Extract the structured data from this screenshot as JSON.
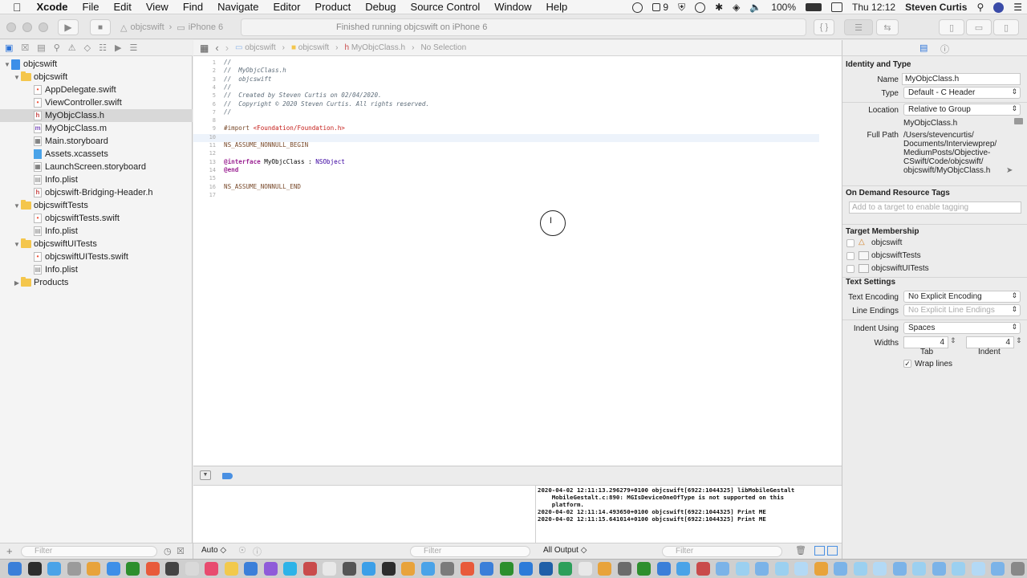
{
  "menubar": {
    "apple": "",
    "app_name": "Xcode",
    "items": [
      "File",
      "Edit",
      "View",
      "Find",
      "Navigate",
      "Editor",
      "Product",
      "Debug",
      "Source Control",
      "Window",
      "Help"
    ],
    "right": {
      "badge": "9",
      "battery": "100%",
      "clock": "Thu 12:12",
      "user": "Steven Curtis"
    }
  },
  "toolbar": {
    "scheme": "objcswift",
    "device": "iPhone 6",
    "activity_status": "Finished running objcswift on iPhone 6"
  },
  "navigator": {
    "rows": [
      {
        "label": "objcswift",
        "kind": "project",
        "level": 0,
        "open": true
      },
      {
        "label": "objcswift",
        "kind": "folder",
        "level": 1,
        "open": true
      },
      {
        "label": "AppDelegate.swift",
        "kind": "swift",
        "level": 2
      },
      {
        "label": "ViewController.swift",
        "kind": "swift",
        "level": 2
      },
      {
        "label": "MyObjcClass.h",
        "kind": "h",
        "level": 2,
        "selected": true
      },
      {
        "label": "MyObjcClass.m",
        "kind": "m",
        "level": 2
      },
      {
        "label": "Main.storyboard",
        "kind": "storyboard",
        "level": 2
      },
      {
        "label": "Assets.xcassets",
        "kind": "assets",
        "level": 2
      },
      {
        "label": "LaunchScreen.storyboard",
        "kind": "storyboard",
        "level": 2
      },
      {
        "label": "Info.plist",
        "kind": "plist",
        "level": 2
      },
      {
        "label": "objcswift-Bridging-Header.h",
        "kind": "h",
        "level": 2
      },
      {
        "label": "objcswiftTests",
        "kind": "folder",
        "level": 1,
        "open": true
      },
      {
        "label": "objcswiftTests.swift",
        "kind": "swift",
        "level": 2
      },
      {
        "label": "Info.plist",
        "kind": "plist",
        "level": 2
      },
      {
        "label": "objcswiftUITests",
        "kind": "folder",
        "level": 1,
        "open": true
      },
      {
        "label": "objcswiftUITests.swift",
        "kind": "swift",
        "level": 2
      },
      {
        "label": "Info.plist",
        "kind": "plist",
        "level": 2
      },
      {
        "label": "Products",
        "kind": "folder",
        "level": 1,
        "open": false
      }
    ],
    "filter_placeholder": "Filter"
  },
  "jumpbar": {
    "crumbs": [
      "objcswift",
      "objcswift",
      "MyObjcClass.h",
      "No Selection"
    ]
  },
  "editor": {
    "lines": [
      {
        "n": "1",
        "parts": [
          {
            "t": "//",
            "c": "cmt"
          }
        ]
      },
      {
        "n": "2",
        "parts": [
          {
            "t": "//  MyObjcClass.h",
            "c": "cmt"
          }
        ]
      },
      {
        "n": "3",
        "parts": [
          {
            "t": "//  objcswift",
            "c": "cmt"
          }
        ]
      },
      {
        "n": "4",
        "parts": [
          {
            "t": "//",
            "c": "cmt"
          }
        ]
      },
      {
        "n": "5",
        "parts": [
          {
            "t": "//  Created by Steven Curtis on 02/04/2020.",
            "c": "cmt"
          }
        ]
      },
      {
        "n": "6",
        "parts": [
          {
            "t": "//  Copyright © 2020 Steven Curtis. All rights reserved.",
            "c": "cmt"
          }
        ]
      },
      {
        "n": "7",
        "parts": [
          {
            "t": "//",
            "c": "cmt"
          }
        ]
      },
      {
        "n": "8",
        "parts": []
      },
      {
        "n": "9",
        "parts": [
          {
            "t": "#import ",
            "c": "pre"
          },
          {
            "t": "<Foundation/Foundation.h>",
            "c": "str"
          }
        ]
      },
      {
        "n": "10",
        "parts": []
      },
      {
        "n": "11",
        "parts": [
          {
            "t": "NS_ASSUME_NONNULL_BEGIN",
            "c": "pre"
          }
        ]
      },
      {
        "n": "12",
        "parts": []
      },
      {
        "n": "13",
        "parts": [
          {
            "t": "@interface",
            "c": "kw"
          },
          {
            "t": " MyObjcClass : ",
            "c": "plain"
          },
          {
            "t": "NSObject",
            "c": "cls"
          }
        ]
      },
      {
        "n": "14",
        "parts": [
          {
            "t": "@end",
            "c": "kw"
          }
        ]
      },
      {
        "n": "15",
        "parts": []
      },
      {
        "n": "16",
        "parts": [
          {
            "t": "NS_ASSUME_NONNULL_END",
            "c": "pre"
          }
        ]
      },
      {
        "n": "17",
        "parts": []
      }
    ]
  },
  "debug": {
    "auto_label": "Auto ◇",
    "variables_filter": "Filter",
    "output_label": "All Output ◇",
    "console_filter": "Filter",
    "console_lines": [
      "2020-04-02 12:11:13.296279+0100 objcswift[6922:1044325] libMobileGestalt",
      "    MobileGestalt.c:890: MGIsDeviceOneOfType is not supported on this",
      "    platform.",
      "2020-04-02 12:11:14.493650+0100 objcswift[6922:1044325] Print ME",
      "2020-04-02 12:11:15.641014+0100 objcswift[6922:1044325] Print ME"
    ]
  },
  "inspector": {
    "identity_title": "Identity and Type",
    "name_label": "Name",
    "name_value": "MyObjcClass.h",
    "type_label": "Type",
    "type_value": "Default - C Header",
    "location_label": "Location",
    "location_value": "Relative to Group",
    "location_file": "MyObjcClass.h",
    "fullpath_label": "Full Path",
    "fullpath_lines": [
      "/Users/stevencurtis/",
      "Documents/Interviewprep/",
      "MediumPosts/Objective-",
      "CSwift/Code/objcswift/",
      "objcswift/MyObjcClass.h"
    ],
    "odr_title": "On Demand Resource Tags",
    "odr_placeholder": "Add to a target to enable tagging",
    "membership_title": "Target Membership",
    "targets": [
      "objcswift",
      "objcswiftTests",
      "objcswiftUITests"
    ],
    "text_settings_title": "Text Settings",
    "encoding_label": "Text Encoding",
    "encoding_value": "No Explicit Encoding",
    "line_endings_label": "Line Endings",
    "line_endings_value": "No Explicit Line Endings",
    "indent_label": "Indent Using",
    "indent_value": "Spaces",
    "widths_label": "Widths",
    "tab_value": "4",
    "indent_width_value": "4",
    "tab_caption": "Tab",
    "indent_caption": "Indent",
    "wrap_label": "Wrap lines"
  },
  "colors": {
    "accent": "#2a72d8",
    "selection": "#d8d8d8",
    "folder": "#f4c64c"
  }
}
